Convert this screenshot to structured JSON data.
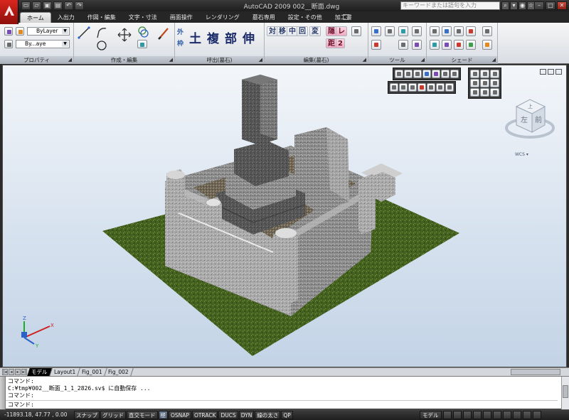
{
  "window": {
    "title": "AutoCAD 2009 002__断面.dwg",
    "search_placeholder": "キーワードまたは語句を入力"
  },
  "quick_access": [
    "new-icon",
    "open-icon",
    "save-icon",
    "plot-icon",
    "undo-icon",
    "redo-icon"
  ],
  "ribbon": {
    "tabs": [
      {
        "label": "ホーム",
        "active": true
      },
      {
        "label": "入出力"
      },
      {
        "label": "作図・編集"
      },
      {
        "label": "文字・寸法"
      },
      {
        "label": "画面操作"
      },
      {
        "label": "レンダリング"
      },
      {
        "label": "墓石専用"
      },
      {
        "label": "設定・その他"
      },
      {
        "label": "加工書"
      }
    ],
    "panels": {
      "properties": {
        "title": "プロパティ",
        "color_value": "ByLayer",
        "linetype_value": "By...aye"
      },
      "draw_edit": {
        "title": "作成・編集"
      },
      "call": {
        "title": "呼出(墓石)",
        "labels": [
          "外",
          "枠",
          "土",
          "複",
          "部",
          "伸"
        ]
      },
      "edit_gravestone": {
        "title": "編集(墓石)",
        "labels": [
          "対",
          "移",
          "中",
          "回",
          "変",
          "隠",
          "レ",
          "距",
          "2"
        ]
      },
      "tools": {
        "title": "ツール"
      },
      "shade": {
        "title": "シェード"
      }
    }
  },
  "viewport": {
    "viewcube": {
      "face_top": "上",
      "face_front": "前",
      "face_left": "左",
      "wcs_label": "WCS"
    },
    "ucs_axes": {
      "x": "X",
      "y": "Y",
      "z": "Z"
    }
  },
  "layout_tabs": [
    {
      "label": "モデル",
      "active": true
    },
    {
      "label": "Layout1"
    },
    {
      "label": "Fig_001"
    },
    {
      "label": "Fig_002"
    }
  ],
  "command_line": {
    "history": [
      "コマンド:",
      "C:¥tmp¥002__断面_1_1_2826.sv$ に自動保存 ...",
      "コマンド:"
    ],
    "prompt": "コマンド:"
  },
  "status": {
    "coordinates": "-11893.18, 47.77 , 0.00",
    "toggles": [
      "スナップ",
      "グリッド",
      "直交モード",
      "極",
      "OSNAP",
      "OTRACK",
      "DUCS",
      "DYN",
      "線の太さ",
      "QP"
    ],
    "model_label": "モデル"
  },
  "colors": {
    "accent_red": "#c8261e",
    "ribbon_bg": "#e6e9ee",
    "viewport_sky": "#d7e2ef",
    "grass": "#3f5a1e",
    "granite": "#8d8d8d"
  }
}
